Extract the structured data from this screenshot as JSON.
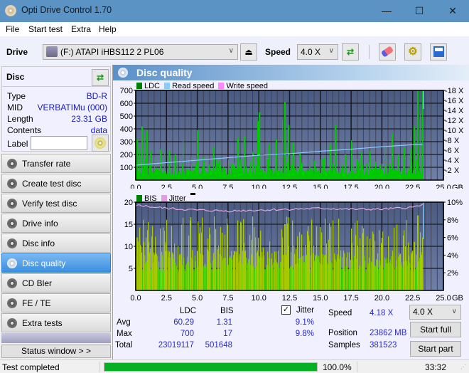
{
  "window": {
    "title": "Opti Drive Control 1.70",
    "minimize": "—",
    "maximize": "☐",
    "close": "✕"
  },
  "menu": [
    "File",
    "Start test",
    "Extra",
    "Help"
  ],
  "toolbar": {
    "drive_label": "Drive",
    "drive_value": "(F:)  ATAPI iHBS112  2 PL06",
    "speed_label": "Speed",
    "speed_value": "4.0 X"
  },
  "disc": {
    "title": "Disc",
    "type_label": "Type",
    "type_value": "BD-R",
    "mid_label": "MID",
    "mid_value": "VERBATIMu (000)",
    "length_label": "Length",
    "length_value": "23.31 GB",
    "contents_label": "Contents",
    "contents_value": "data",
    "label_label": "Label",
    "label_value": ""
  },
  "nav": [
    {
      "label": "Transfer rate",
      "active": false
    },
    {
      "label": "Create test disc",
      "active": false
    },
    {
      "label": "Verify test disc",
      "active": false
    },
    {
      "label": "Drive info",
      "active": false
    },
    {
      "label": "Disc info",
      "active": false
    },
    {
      "label": "Disc quality",
      "active": true
    },
    {
      "label": "CD Bler",
      "active": false
    },
    {
      "label": "FE / TE",
      "active": false
    },
    {
      "label": "Extra tests",
      "active": false
    }
  ],
  "status_window_label": "Status window > >",
  "panel": {
    "title": "Disc quality"
  },
  "chart_data": [
    {
      "type": "bar",
      "title": "LDC / Read speed",
      "legend": [
        {
          "name": "LDC",
          "color": "#008000"
        },
        {
          "name": "Read speed",
          "color": "#88ccff"
        },
        {
          "name": "Write speed",
          "color": "#ff88ff"
        }
      ],
      "xlabel": "GB",
      "xlim": [
        0,
        25
      ],
      "x_ticks": [
        "0.0",
        "2.5",
        "5.0",
        "7.5",
        "10.0",
        "12.5",
        "15.0",
        "17.5",
        "20.0",
        "22.5",
        "25.0"
      ],
      "ylim": [
        0,
        700
      ],
      "y_ticks": [
        "100",
        "200",
        "300",
        "400",
        "500",
        "600",
        "700"
      ],
      "y2lim": [
        0,
        18
      ],
      "y2_ticks": [
        "2 X",
        "4 X",
        "6 X",
        "8 X",
        "10 X",
        "12 X",
        "14 X",
        "16 X",
        "18 X"
      ],
      "data_end_gb": 23.31,
      "ldc_baseline": 60,
      "ldc_peaks": [
        [
          0.1,
          320
        ],
        [
          0.3,
          240
        ],
        [
          0.5,
          420
        ],
        [
          0.7,
          350
        ],
        [
          0.9,
          390
        ],
        [
          1.2,
          230
        ],
        [
          1.5,
          180
        ],
        [
          2.0,
          240
        ],
        [
          2.3,
          220
        ],
        [
          2.7,
          230
        ],
        [
          3.2,
          200
        ],
        [
          3.8,
          310
        ],
        [
          4.5,
          180
        ],
        [
          5.0,
          390
        ],
        [
          5.5,
          180
        ],
        [
          6.3,
          260
        ],
        [
          6.8,
          150
        ],
        [
          7.5,
          160
        ],
        [
          8.3,
          330
        ],
        [
          8.8,
          340
        ],
        [
          9.5,
          220
        ],
        [
          9.9,
          460
        ],
        [
          10.0,
          530
        ],
        [
          10.8,
          280
        ],
        [
          11.4,
          320
        ],
        [
          11.9,
          470
        ],
        [
          12.1,
          610
        ],
        [
          12.4,
          430
        ],
        [
          12.8,
          290
        ],
        [
          13.3,
          210
        ],
        [
          14.2,
          170
        ],
        [
          15.3,
          180
        ],
        [
          15.8,
          280
        ],
        [
          16.2,
          430
        ],
        [
          17.0,
          200
        ],
        [
          17.5,
          310
        ],
        [
          18.3,
          220
        ],
        [
          19.0,
          230
        ],
        [
          20.2,
          260
        ],
        [
          20.8,
          360
        ],
        [
          21.3,
          200
        ],
        [
          21.8,
          250
        ],
        [
          22.3,
          240
        ],
        [
          22.6,
          420
        ],
        [
          22.9,
          700
        ],
        [
          23.1,
          520
        ],
        [
          23.3,
          700
        ]
      ],
      "read_speed": [
        [
          0,
          3.0
        ],
        [
          1,
          3.2
        ],
        [
          2.5,
          3.5
        ],
        [
          5,
          4.0
        ],
        [
          7.5,
          4.5
        ],
        [
          10,
          5.0
        ],
        [
          12.5,
          5.3
        ],
        [
          15,
          5.8
        ],
        [
          17.5,
          6.2
        ],
        [
          20,
          6.7
        ],
        [
          22.5,
          7.1
        ],
        [
          23.31,
          7.2
        ]
      ]
    },
    {
      "type": "bar",
      "title": "BIS / Jitter",
      "legend": [
        {
          "name": "BIS",
          "color": "#008000"
        },
        {
          "name": "Jitter",
          "color": "#dda0dd"
        }
      ],
      "xlabel": "GB",
      "xlim": [
        0,
        25
      ],
      "x_ticks": [
        "0.0",
        "2.5",
        "5.0",
        "7.5",
        "10.0",
        "12.5",
        "15.0",
        "17.5",
        "20.0",
        "22.5",
        "25.0"
      ],
      "ylim": [
        0,
        20
      ],
      "y_ticks": [
        "5",
        "10",
        "15",
        "20"
      ],
      "y2lim": [
        0,
        10
      ],
      "y2_ticks": [
        "2%",
        "4%",
        "6%",
        "8%",
        "10%"
      ],
      "data_end_gb": 23.31,
      "bis_baseline": 6,
      "bis_peaks": [
        [
          0.1,
          12
        ],
        [
          0.4,
          10
        ],
        [
          0.6,
          11
        ],
        [
          0.8,
          12
        ],
        [
          1.0,
          9
        ],
        [
          1.3,
          8
        ],
        [
          2.6,
          9
        ],
        [
          2.9,
          8
        ],
        [
          3.7,
          9
        ],
        [
          5.3,
          7
        ],
        [
          8.7,
          9
        ],
        [
          9.7,
          12
        ],
        [
          9.9,
          9
        ],
        [
          11.9,
          12
        ],
        [
          12.1,
          15
        ],
        [
          12.4,
          10
        ],
        [
          15.3,
          8
        ],
        [
          16.6,
          7
        ],
        [
          20.5,
          10
        ],
        [
          21.9,
          10
        ],
        [
          22.6,
          11
        ],
        [
          22.9,
          17
        ],
        [
          23.1,
          11
        ],
        [
          23.3,
          12
        ]
      ],
      "jitter": [
        [
          0,
          9.5
        ],
        [
          0.3,
          9.7
        ],
        [
          1,
          9.5
        ],
        [
          2.5,
          9.3
        ],
        [
          5,
          9.1
        ],
        [
          7.5,
          9.0
        ],
        [
          10,
          9.1
        ],
        [
          12.5,
          9.2
        ],
        [
          15,
          9.3
        ],
        [
          17.5,
          9.2
        ],
        [
          20,
          9.2
        ],
        [
          22.5,
          9.4
        ],
        [
          23.31,
          9.8
        ]
      ]
    }
  ],
  "stats": {
    "col_ldc": "LDC",
    "col_bis": "BIS",
    "avg_label": "Avg",
    "avg_ldc": "60.29",
    "avg_bis": "1.31",
    "max_label": "Max",
    "max_ldc": "700",
    "max_bis": "17",
    "total_label": "Total",
    "total_ldc": "23019117",
    "total_bis": "501648",
    "jitter_label": "Jitter",
    "jitter_checked": true,
    "jitter_avg": "9.1%",
    "jitter_max": "9.8%",
    "speed_label": "Speed",
    "speed_value": "4.18 X",
    "position_label": "Position",
    "position_value": "23862 MB",
    "samples_label": "Samples",
    "samples_value": "381523",
    "speed_select": "4.0 X",
    "start_full": "Start full",
    "start_part": "Start part"
  },
  "statusbar": {
    "text": "Test completed",
    "progress": 100.0,
    "progress_text": "100.0%",
    "time": "33:32"
  }
}
